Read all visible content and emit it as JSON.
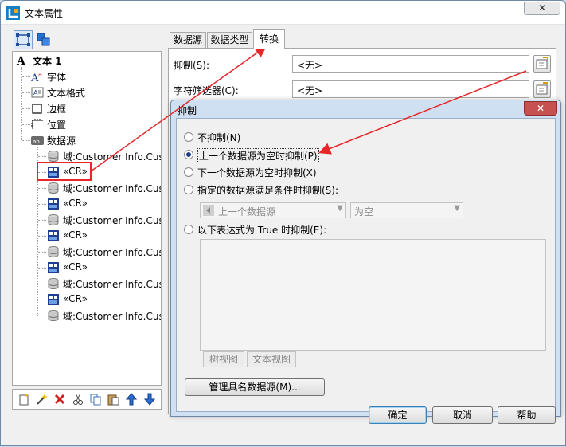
{
  "window": {
    "title": "文本属性",
    "close_label": "✕"
  },
  "left_panel": {
    "toolbar_icons": [
      "tree-view-icon",
      "layers-icon"
    ],
    "tree": {
      "root": "文本 1",
      "children": [
        {
          "label": "字体",
          "icon": "font-icon"
        },
        {
          "label": "文本格式",
          "icon": "text-format-icon"
        },
        {
          "label": "边框",
          "icon": "border-icon"
        },
        {
          "label": "位置",
          "icon": "position-icon"
        },
        {
          "label": "数据源",
          "icon": "datasource-icon"
        }
      ],
      "datasource_items": [
        {
          "label": "域:Customer Info.Cus",
          "icon": "database-icon"
        },
        {
          "label": "«CR»",
          "icon": "crlf-icon"
        },
        {
          "label": "域:Customer Info.Cus",
          "icon": "database-icon"
        },
        {
          "label": "«CR»",
          "icon": "crlf-icon"
        },
        {
          "label": "域:Customer Info.Cus",
          "icon": "database-icon"
        },
        {
          "label": "«CR»",
          "icon": "crlf-icon"
        },
        {
          "label": "域:Customer Info.Cus",
          "icon": "database-icon"
        },
        {
          "label": "«CR»",
          "icon": "crlf-icon"
        },
        {
          "label": "域:Customer Info.Cus",
          "icon": "database-icon"
        },
        {
          "label": "«CR»",
          "icon": "crlf-icon"
        },
        {
          "label": "域:Customer Info.Cus",
          "icon": "database-icon"
        }
      ]
    },
    "bottom_toolbar_icons": [
      "new-icon",
      "wand-icon",
      "delete-icon",
      "cut-icon",
      "copy-icon",
      "paste-icon",
      "move-up-icon",
      "move-down-icon"
    ]
  },
  "tabs": [
    "数据源",
    "数据类型",
    "转换"
  ],
  "active_tab": "转换",
  "right_panel": {
    "suppress_label": "抑制(S):",
    "suppress_value": "<无>",
    "char_filter_label": "字符筛选器(C):",
    "char_filter_value": "<无>"
  },
  "dialog": {
    "title": "抑制",
    "close_label": "✕",
    "options": [
      {
        "label": "不抑制(N)",
        "checked": false
      },
      {
        "label": "上一个数据源为空时抑制(P)",
        "checked": true
      },
      {
        "label": "下一个数据源为空时抑制(X)",
        "checked": false
      },
      {
        "label": "指定的数据源满足条件时抑制(S):",
        "checked": false
      }
    ],
    "condition_source": "上一个数据源",
    "condition_value": "为空",
    "expression_option": {
      "label": "以下表达式为 True 时抑制(E):",
      "checked": false
    },
    "mini_tabs": [
      "树视图",
      "文本视图"
    ],
    "manage_button": "管理具名数据源(M)...",
    "ok_button": "确定",
    "cancel_button": "取消",
    "help_button": "帮助"
  },
  "colors": {
    "annotation_red": "#e8262a",
    "radio_fill": "#1b3e86",
    "dialog_frame": "#cfe0f2"
  }
}
